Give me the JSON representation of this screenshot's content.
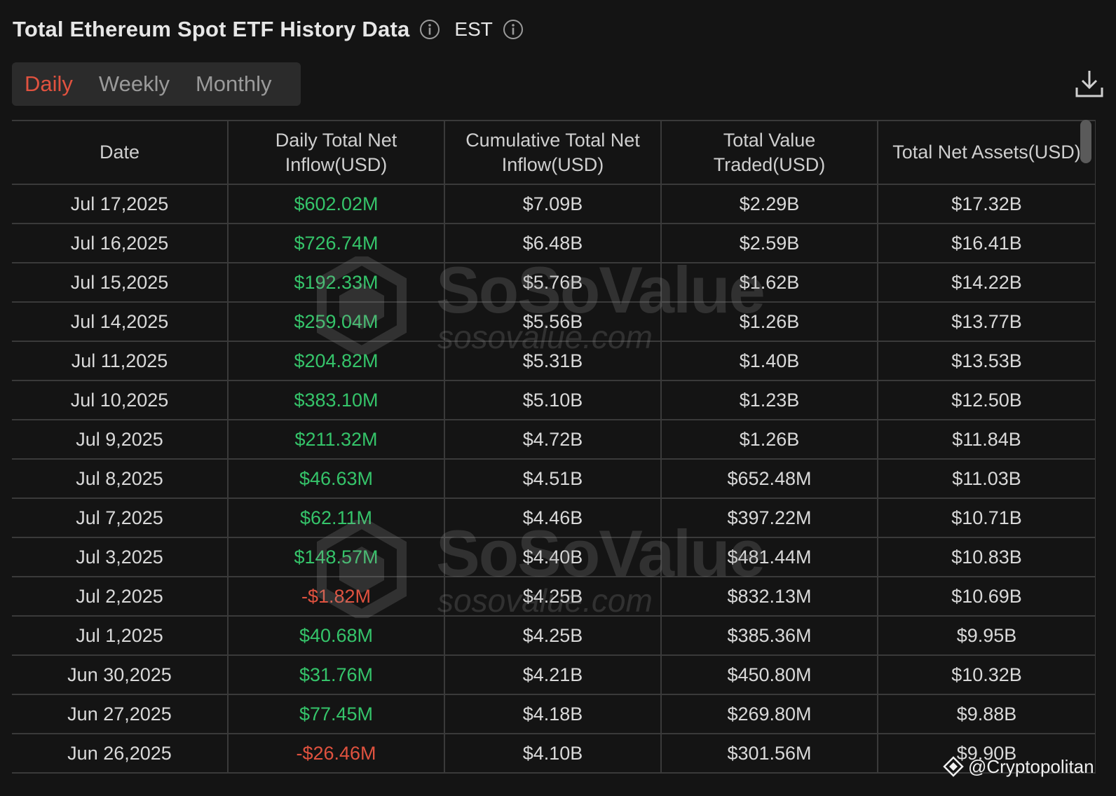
{
  "header": {
    "title": "Total Ethereum Spot ETF History Data",
    "timezone": "EST"
  },
  "tabs": [
    {
      "label": "Daily",
      "active": true
    },
    {
      "label": "Weekly",
      "active": false
    },
    {
      "label": "Monthly",
      "active": false
    }
  ],
  "toolbar": {
    "download_icon": "download-icon"
  },
  "table": {
    "headers": [
      "Date",
      "Daily Total Net Inflow(USD)",
      "Cumulative Total Net Inflow(USD)",
      "Total Value Traded(USD)",
      "Total Net Assets(USD)"
    ],
    "rows": [
      {
        "date": "Jul 17,2025",
        "daily": "$602.02M",
        "cumulative": "$7.09B",
        "traded": "$2.29B",
        "assets": "$17.32B"
      },
      {
        "date": "Jul 16,2025",
        "daily": "$726.74M",
        "cumulative": "$6.48B",
        "traded": "$2.59B",
        "assets": "$16.41B"
      },
      {
        "date": "Jul 15,2025",
        "daily": "$192.33M",
        "cumulative": "$5.76B",
        "traded": "$1.62B",
        "assets": "$14.22B"
      },
      {
        "date": "Jul 14,2025",
        "daily": "$259.04M",
        "cumulative": "$5.56B",
        "traded": "$1.26B",
        "assets": "$13.77B"
      },
      {
        "date": "Jul 11,2025",
        "daily": "$204.82M",
        "cumulative": "$5.31B",
        "traded": "$1.40B",
        "assets": "$13.53B"
      },
      {
        "date": "Jul 10,2025",
        "daily": "$383.10M",
        "cumulative": "$5.10B",
        "traded": "$1.23B",
        "assets": "$12.50B"
      },
      {
        "date": "Jul 9,2025",
        "daily": "$211.32M",
        "cumulative": "$4.72B",
        "traded": "$1.26B",
        "assets": "$11.84B"
      },
      {
        "date": "Jul 8,2025",
        "daily": "$46.63M",
        "cumulative": "$4.51B",
        "traded": "$652.48M",
        "assets": "$11.03B"
      },
      {
        "date": "Jul 7,2025",
        "daily": "$62.11M",
        "cumulative": "$4.46B",
        "traded": "$397.22M",
        "assets": "$10.71B"
      },
      {
        "date": "Jul 3,2025",
        "daily": "$148.57M",
        "cumulative": "$4.40B",
        "traded": "$481.44M",
        "assets": "$10.83B"
      },
      {
        "date": "Jul 2,2025",
        "daily": "-$1.82M",
        "cumulative": "$4.25B",
        "traded": "$832.13M",
        "assets": "$10.69B"
      },
      {
        "date": "Jul 1,2025",
        "daily": "$40.68M",
        "cumulative": "$4.25B",
        "traded": "$385.36M",
        "assets": "$9.95B"
      },
      {
        "date": "Jun 30,2025",
        "daily": "$31.76M",
        "cumulative": "$4.21B",
        "traded": "$450.80M",
        "assets": "$10.32B"
      },
      {
        "date": "Jun 27,2025",
        "daily": "$77.45M",
        "cumulative": "$4.18B",
        "traded": "$269.80M",
        "assets": "$9.88B"
      },
      {
        "date": "Jun 26,2025",
        "daily": "-$26.46M",
        "cumulative": "$4.10B",
        "traded": "$301.56M",
        "assets": "$9.90B"
      }
    ]
  },
  "watermark": {
    "name": "SoSoValue",
    "url": "sosovalue.com"
  },
  "credit": {
    "text": "@Cryptopolitan"
  },
  "colors": {
    "positive": "#35c46a",
    "negative": "#e0523f",
    "active_tab": "#e0523f",
    "background": "#141414"
  }
}
